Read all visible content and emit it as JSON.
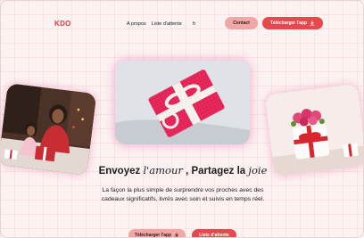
{
  "brand": {
    "logo": "KDO"
  },
  "nav": {
    "items": [
      "A propos",
      "Liste d'attente"
    ],
    "lang": "fr"
  },
  "header": {
    "contact_label": "Contact",
    "download_label": "Télécharger l'app"
  },
  "hero": {
    "title_a": "Envoyez ",
    "title_b": "l'amour",
    "title_c": " , Partagez la ",
    "title_d": "joie",
    "subtitle": "La façon la plus simple de surprendre vos proches avec des cadeaux significatifs, livrés avec soin et suivis en temps réel.",
    "download_label": "Télécharger l'app",
    "waitlist_label": "Liste d'attente"
  },
  "images": {
    "left": "family-gift-photo",
    "center": "pink-gift-box-photo",
    "right": "flower-gift-box-photo"
  },
  "colors": {
    "accent": "#e5484d",
    "accent_light": "#f2a7a7",
    "background": "#fdf2f2"
  }
}
